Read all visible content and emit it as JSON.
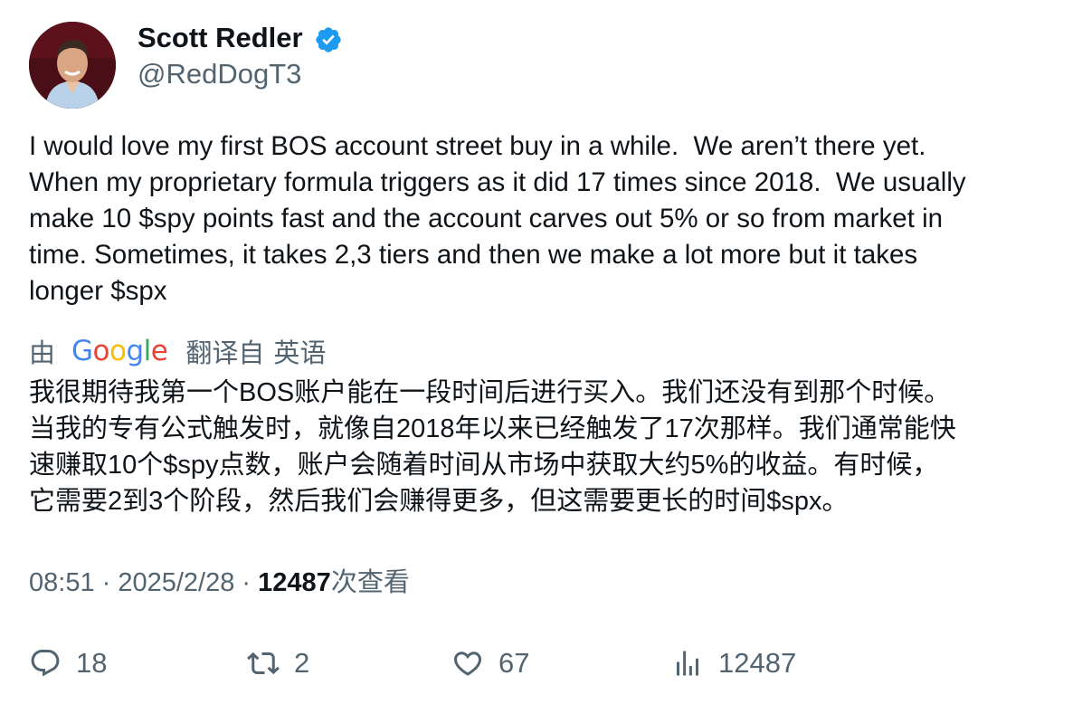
{
  "author": {
    "display_name": "Scott Redler",
    "handle": "@RedDogT3",
    "verified": true,
    "avatar_icon": "profile-photo"
  },
  "tweet": {
    "lines": [
      "I would love my first BOS account street buy in a while.  We aren’t there yet.",
      "When my proprietary formula triggers as it did 17 times since 2018.  We usually",
      "make 10 $spy points fast and the account carves out 5% or so from market in",
      "time. Sometimes, it takes 2,3 tiers and then we make a lot more but it takes",
      "longer $spx"
    ]
  },
  "translation": {
    "by_label": "由",
    "provider": "Google",
    "translated_from": "翻译自",
    "language": "英语",
    "lines": [
      "我很期待我第一个BOS账户能在一段时间后进行买入。我们还没有到那个时候。",
      "当我的专有公式触发时，就像自2018年以来已经触发了17次那样。我们通常能快",
      "速赚取10个$spy点数，账户会随着时间从市场中获取大约5%的收益。有时候，",
      "它需要2到3个阶段，然后我们会赚得更多，但这需要更长的时间$spx。"
    ]
  },
  "meta": {
    "time": "08:51",
    "separator": " · ",
    "date": "2025/2/28",
    "views_count": "12487",
    "views_label": "次查看"
  },
  "actions": {
    "replies": "18",
    "retweets": "2",
    "likes": "67",
    "views": "12487"
  },
  "colors": {
    "text": "#0f1419",
    "secondary": "#536471",
    "verified_blue": "#1d9bf0"
  }
}
